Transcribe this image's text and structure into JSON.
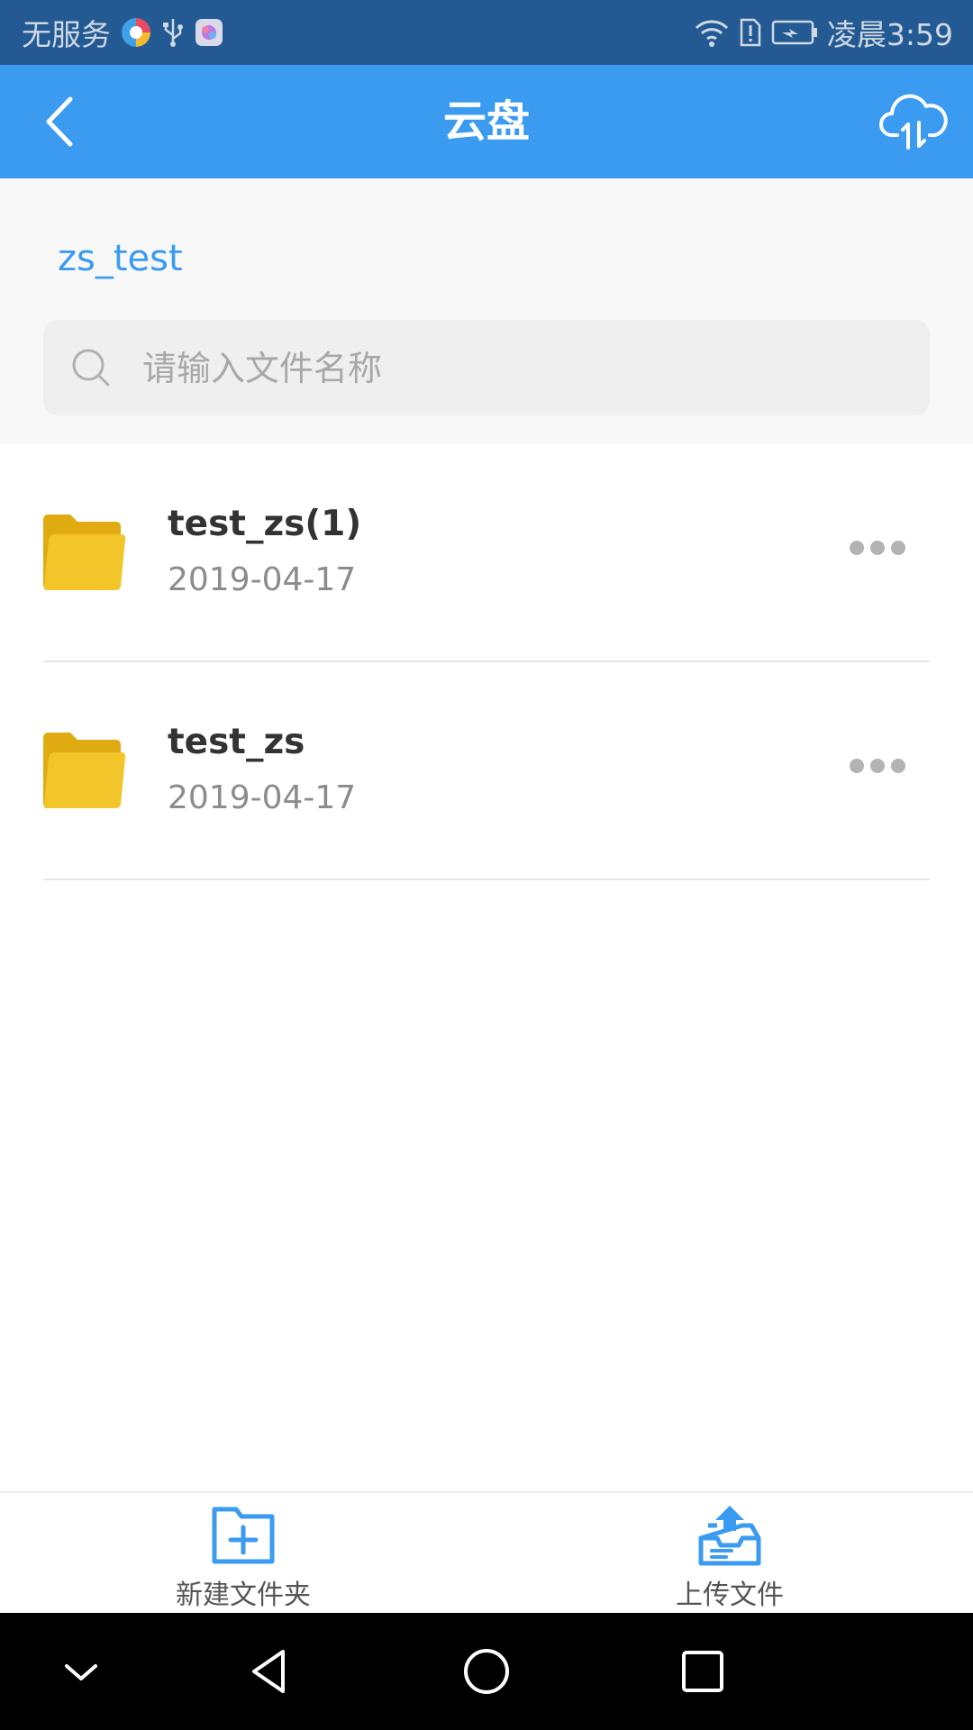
{
  "status_bar": {
    "carrier": "无服务",
    "time": "凌晨3:59",
    "icons": [
      "browser-app-icon",
      "usb-icon",
      "app-notification-icon",
      "wifi-icon",
      "sim-alert-icon",
      "battery-charging-icon"
    ]
  },
  "app_bar": {
    "title": "云盘",
    "back_icon": "chevron-left-icon",
    "action_icon": "cloud-transfer-icon"
  },
  "breadcrumb": "zs_test",
  "search": {
    "placeholder": "请输入文件名称",
    "value": ""
  },
  "files": [
    {
      "name": "test_zs(1)",
      "date": "2019-04-17",
      "icon": "folder-icon"
    },
    {
      "name": "test_zs",
      "date": "2019-04-17",
      "icon": "folder-icon"
    }
  ],
  "bottom_actions": [
    {
      "label": "新建文件夹",
      "icon": "new-folder-icon"
    },
    {
      "label": "上传文件",
      "icon": "upload-file-icon"
    }
  ],
  "colors": {
    "status_bar": "#235a93",
    "primary": "#3a9bf0",
    "folder": "#f0c321"
  }
}
